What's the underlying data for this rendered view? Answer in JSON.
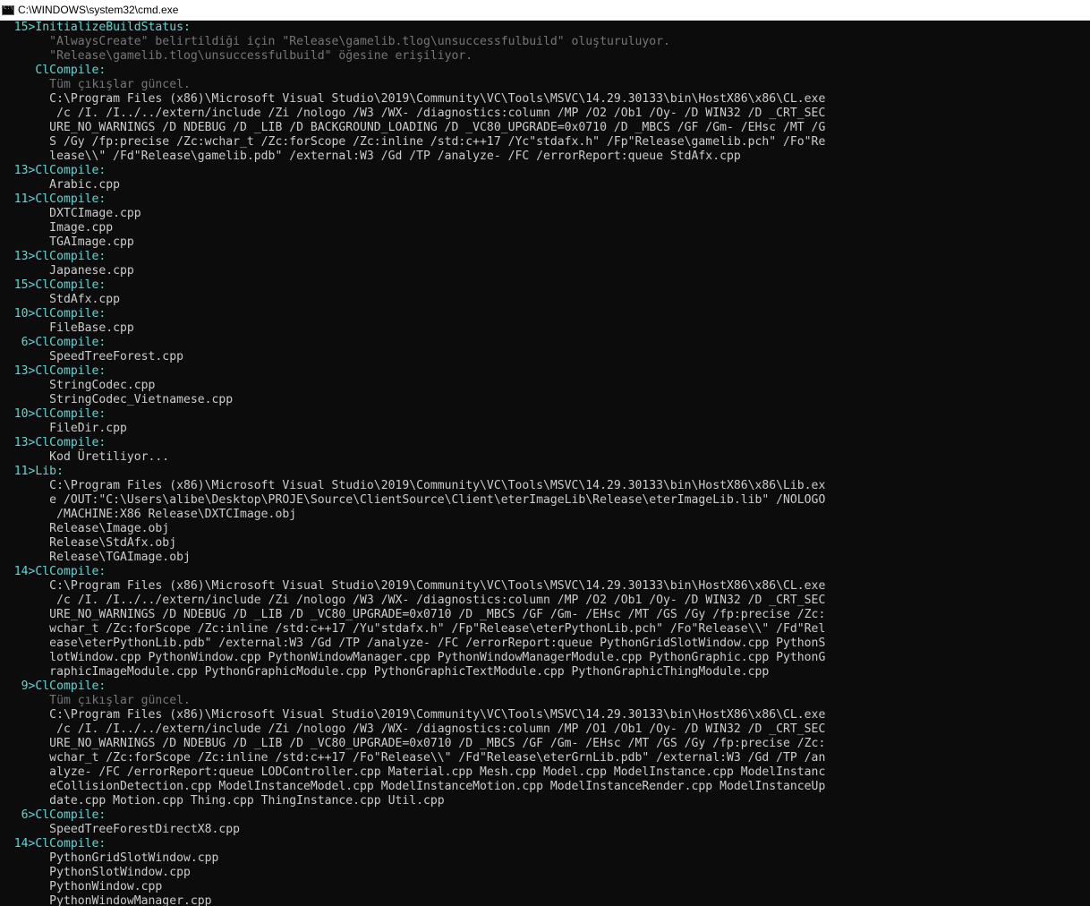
{
  "window": {
    "title": "C:\\WINDOWS\\system32\\cmd.exe"
  },
  "colors": {
    "background": "#0c0c0c",
    "text": "#cccccc",
    "cyan": "#61d6d6",
    "gray": "#767676"
  },
  "lines": [
    {
      "text": "  15>InitializeBuildStatus:",
      "color": "cyan"
    },
    {
      "text": "       \"AlwaysCreate\" belirtildiği için \"Release\\gamelib.tlog\\unsuccessfulbuild\" oluşturuluyor.",
      "color": "gray"
    },
    {
      "text": "       \"Release\\gamelib.tlog\\unsuccessfulbuild\" öğesine erişiliyor.",
      "color": "gray"
    },
    {
      "text": "     ClCompile:",
      "color": "cyan"
    },
    {
      "text": "       Tüm çıkışlar güncel.",
      "color": "gray"
    },
    {
      "text": "       C:\\Program Files (x86)\\Microsoft Visual Studio\\2019\\Community\\VC\\Tools\\MSVC\\14.29.30133\\bin\\HostX86\\x86\\CL.exe",
      "color": "white"
    },
    {
      "text": "        /c /I. /I../../extern/include /Zi /nologo /W3 /WX- /diagnostics:column /MP /O2 /Ob1 /Oy- /D WIN32 /D _CRT_SEC",
      "color": "white"
    },
    {
      "text": "       URE_NO_WARNINGS /D NDEBUG /D _LIB /D BACKGROUND_LOADING /D _VC80_UPGRADE=0x0710 /D _MBCS /GF /Gm- /EHsc /MT /G",
      "color": "white"
    },
    {
      "text": "       S /Gy /fp:precise /Zc:wchar_t /Zc:forScope /Zc:inline /std:c++17 /Yc\"stdafx.h\" /Fp\"Release\\gamelib.pch\" /Fo\"Re",
      "color": "white"
    },
    {
      "text": "       lease\\\\\" /Fd\"Release\\gamelib.pdb\" /external:W3 /Gd /TP /analyze- /FC /errorReport:queue StdAfx.cpp",
      "color": "white"
    },
    {
      "text": "  13>ClCompile:",
      "color": "cyan"
    },
    {
      "text": "       Arabic.cpp",
      "color": "white"
    },
    {
      "text": "  11>ClCompile:",
      "color": "cyan"
    },
    {
      "text": "       DXTCImage.cpp",
      "color": "white"
    },
    {
      "text": "       Image.cpp",
      "color": "white"
    },
    {
      "text": "       TGAImage.cpp",
      "color": "white"
    },
    {
      "text": "  13>ClCompile:",
      "color": "cyan"
    },
    {
      "text": "       Japanese.cpp",
      "color": "white"
    },
    {
      "text": "  15>ClCompile:",
      "color": "cyan"
    },
    {
      "text": "       StdAfx.cpp",
      "color": "white"
    },
    {
      "text": "  10>ClCompile:",
      "color": "cyan"
    },
    {
      "text": "       FileBase.cpp",
      "color": "white"
    },
    {
      "text": "   6>ClCompile:",
      "color": "cyan"
    },
    {
      "text": "       SpeedTreeForest.cpp",
      "color": "white"
    },
    {
      "text": "  13>ClCompile:",
      "color": "cyan"
    },
    {
      "text": "       StringCodec.cpp",
      "color": "white"
    },
    {
      "text": "       StringCodec_Vietnamese.cpp",
      "color": "white"
    },
    {
      "text": "  10>ClCompile:",
      "color": "cyan"
    },
    {
      "text": "       FileDir.cpp",
      "color": "white"
    },
    {
      "text": "  13>ClCompile:",
      "color": "cyan"
    },
    {
      "text": "       Kod Üretiliyor...",
      "color": "white"
    },
    {
      "text": "  11>Lib:",
      "color": "cyan"
    },
    {
      "text": "       C:\\Program Files (x86)\\Microsoft Visual Studio\\2019\\Community\\VC\\Tools\\MSVC\\14.29.30133\\bin\\HostX86\\x86\\Lib.ex",
      "color": "white"
    },
    {
      "text": "       e /OUT:\"C:\\Users\\alibe\\Desktop\\PROJE\\Source\\ClientSource\\Client\\eterImageLib\\Release\\eterImageLib.lib\" /NOLOGO",
      "color": "white"
    },
    {
      "text": "        /MACHINE:X86 Release\\DXTCImage.obj",
      "color": "white"
    },
    {
      "text": "       Release\\Image.obj",
      "color": "white"
    },
    {
      "text": "       Release\\StdAfx.obj",
      "color": "white"
    },
    {
      "text": "       Release\\TGAImage.obj",
      "color": "white"
    },
    {
      "text": "  14>ClCompile:",
      "color": "cyan"
    },
    {
      "text": "       C:\\Program Files (x86)\\Microsoft Visual Studio\\2019\\Community\\VC\\Tools\\MSVC\\14.29.30133\\bin\\HostX86\\x86\\CL.exe",
      "color": "white"
    },
    {
      "text": "        /c /I. /I../../extern/include /Zi /nologo /W3 /WX- /diagnostics:column /MP /O2 /Ob1 /Oy- /D WIN32 /D _CRT_SEC",
      "color": "white"
    },
    {
      "text": "       URE_NO_WARNINGS /D NDEBUG /D _LIB /D _VC80_UPGRADE=0x0710 /D _MBCS /GF /Gm- /EHsc /MT /GS /Gy /fp:precise /Zc:",
      "color": "white"
    },
    {
      "text": "       wchar_t /Zc:forScope /Zc:inline /std:c++17 /Yu\"stdafx.h\" /Fp\"Release\\eterPythonLib.pch\" /Fo\"Release\\\\\" /Fd\"Rel",
      "color": "white"
    },
    {
      "text": "       ease\\eterPythonLib.pdb\" /external:W3 /Gd /TP /analyze- /FC /errorReport:queue PythonGridSlotWindow.cpp PythonS",
      "color": "white"
    },
    {
      "text": "       lotWindow.cpp PythonWindow.cpp PythonWindowManager.cpp PythonWindowManagerModule.cpp PythonGraphic.cpp PythonG",
      "color": "white"
    },
    {
      "text": "       raphicImageModule.cpp PythonGraphicModule.cpp PythonGraphicTextModule.cpp PythonGraphicThingModule.cpp",
      "color": "white"
    },
    {
      "text": "   9>ClCompile:",
      "color": "cyan"
    },
    {
      "text": "       Tüm çıkışlar güncel.",
      "color": "gray"
    },
    {
      "text": "       C:\\Program Files (x86)\\Microsoft Visual Studio\\2019\\Community\\VC\\Tools\\MSVC\\14.29.30133\\bin\\HostX86\\x86\\CL.exe",
      "color": "white"
    },
    {
      "text": "        /c /I. /I../../extern/include /Zi /nologo /W3 /WX- /diagnostics:column /MP /O1 /Ob1 /Oy- /D WIN32 /D _CRT_SEC",
      "color": "white"
    },
    {
      "text": "       URE_NO_WARNINGS /D NDEBUG /D _LIB /D _VC80_UPGRADE=0x0710 /D _MBCS /GF /Gm- /EHsc /MT /GS /Gy /fp:precise /Zc:",
      "color": "white"
    },
    {
      "text": "       wchar_t /Zc:forScope /Zc:inline /std:c++17 /Fo\"Release\\\\\" /Fd\"Release\\eterGrnLib.pdb\" /external:W3 /Gd /TP /an",
      "color": "white"
    },
    {
      "text": "       alyze- /FC /errorReport:queue LODController.cpp Material.cpp Mesh.cpp Model.cpp ModelInstance.cpp ModelInstanc",
      "color": "white"
    },
    {
      "text": "       eCollisionDetection.cpp ModelInstanceModel.cpp ModelInstanceMotion.cpp ModelInstanceRender.cpp ModelInstanceUp",
      "color": "white"
    },
    {
      "text": "       date.cpp Motion.cpp Thing.cpp ThingInstance.cpp Util.cpp",
      "color": "white"
    },
    {
      "text": "   6>ClCompile:",
      "color": "cyan"
    },
    {
      "text": "       SpeedTreeForestDirectX8.cpp",
      "color": "white"
    },
    {
      "text": "  14>ClCompile:",
      "color": "cyan"
    },
    {
      "text": "       PythonGridSlotWindow.cpp",
      "color": "white"
    },
    {
      "text": "       PythonSlotWindow.cpp",
      "color": "white"
    },
    {
      "text": "       PythonWindow.cpp",
      "color": "white"
    },
    {
      "text": "       PythonWindowManager.cpp",
      "color": "white"
    }
  ]
}
